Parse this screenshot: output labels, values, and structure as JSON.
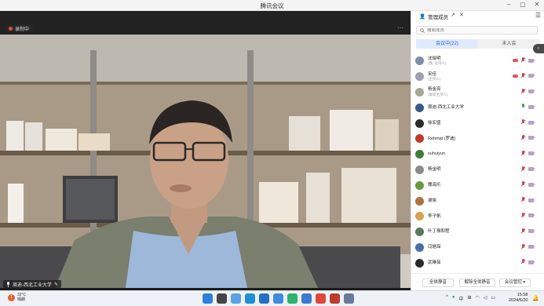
{
  "window": {
    "title": "腾讯会议",
    "controls": [
      "–",
      "▢",
      "✕"
    ]
  },
  "video": {
    "recording_label": "录制中",
    "more_label": "···",
    "speaker_label": "周迪-西北工业大学"
  },
  "panel": {
    "title": "管理成员",
    "popout_icon": "↗",
    "close_icon": "✕",
    "menu_icon": "☰",
    "search_placeholder": "搜索成员",
    "tabs": [
      {
        "label": "会议中(22)",
        "active": true
      },
      {
        "label": "未入会",
        "active": false
      }
    ],
    "members": [
      {
        "name": "沈晓明",
        "role": "(我, 主持人)",
        "avatar_color": "#7a8fa8",
        "mic": "off",
        "cloud": true
      },
      {
        "name": "宋佳",
        "role": "(主持人)",
        "avatar_color": "#9aa0b0",
        "mic": "off",
        "cloud": true
      },
      {
        "name": "杨金亮",
        "role": "(联席主持人)",
        "avatar_color": "#a4a890",
        "mic": "off",
        "cloud": false
      },
      {
        "name": "周迪-西北工业大学",
        "role": "",
        "avatar_color": "#3a5a8a",
        "mic": "on",
        "cloud": false
      },
      {
        "name": "徐宏盛",
        "role": "",
        "avatar_color": "#2b2b2b",
        "mic": "off",
        "cloud": false
      },
      {
        "name": "Rehmat (罗迪)",
        "role": "",
        "avatar_color": "#c0392b",
        "mic": "off",
        "cloud": false
      },
      {
        "name": "xuhuiyun",
        "role": "",
        "avatar_color": "#3e7d3a",
        "mic": "off",
        "cloud": false
      },
      {
        "name": "杨金明",
        "role": "",
        "avatar_color": "#8a8a8a",
        "mic": "off",
        "cloud": false
      },
      {
        "name": "魏海乐",
        "role": "",
        "avatar_color": "#6b9a3c",
        "mic": "off",
        "cloud": false
      },
      {
        "name": "谢晓",
        "role": "",
        "avatar_color": "#b07040",
        "mic": "off",
        "cloud": false
      },
      {
        "name": "李子帆",
        "role": "",
        "avatar_color": "#d8a050",
        "mic": "off",
        "cloud": false
      },
      {
        "name": "叶丁振和程",
        "role": "",
        "avatar_color": "#5a7a5a",
        "mic": "off",
        "cloud": false
      },
      {
        "name": "闫皓琛",
        "role": "",
        "avatar_color": "#4a6ea8",
        "mic": "off",
        "cloud": false
      },
      {
        "name": "武琳茹",
        "role": "",
        "avatar_color": "#2a2a2a",
        "mic": "off",
        "cloud": false
      }
    ],
    "footer": {
      "mute_all": "全体静音",
      "unmute_all": "解除全体静音",
      "manage": "会议管控 ▾"
    }
  },
  "taskbar": {
    "weather_badge": "1",
    "temperature": "32°C",
    "weather_desc": "晴朗",
    "time": "15:58",
    "date": "2024/6/20",
    "tray_caret": "^",
    "tray_lang": "中",
    "tray_ime": "⊞"
  }
}
